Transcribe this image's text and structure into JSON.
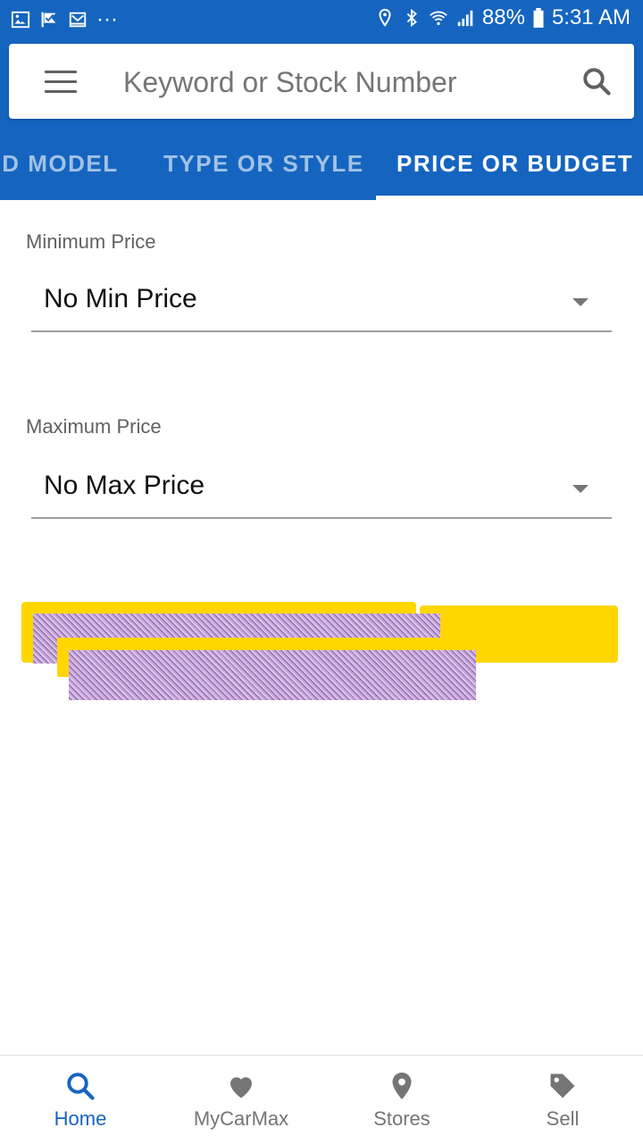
{
  "statusbar": {
    "left_icons": [
      "image-icon",
      "check-flag-icon",
      "mail-icon",
      "more-dots-icon"
    ],
    "more": "···",
    "battery": "88%",
    "time": "5:31 AM",
    "right_icons": [
      "location-icon",
      "bluetooth-icon",
      "wifi-icon",
      "signal-icon",
      "battery-icon"
    ]
  },
  "search": {
    "placeholder": "Keyword or Stock Number"
  },
  "tabs": {
    "items": [
      {
        "label": "ND MODEL",
        "active": false
      },
      {
        "label": "TYPE OR STYLE",
        "active": false
      },
      {
        "label": "PRICE OR BUDGET",
        "active": true
      }
    ]
  },
  "filters": {
    "min_label": "Minimum Price",
    "min_value": "No Min Price",
    "max_label": "Maximum Price",
    "max_value": "No Max Price"
  },
  "bottom_nav": {
    "items": [
      {
        "label": "Home",
        "icon": "search-icon",
        "active": true
      },
      {
        "label": "MyCarMax",
        "icon": "heart-icon",
        "active": false
      },
      {
        "label": "Stores",
        "icon": "location-pin-icon",
        "active": false
      },
      {
        "label": "Sell",
        "icon": "tag-icon",
        "active": false
      }
    ]
  },
  "colors": {
    "primary": "#1565c0",
    "accent_yellow": "#ffd600",
    "inactive": "#757575"
  }
}
